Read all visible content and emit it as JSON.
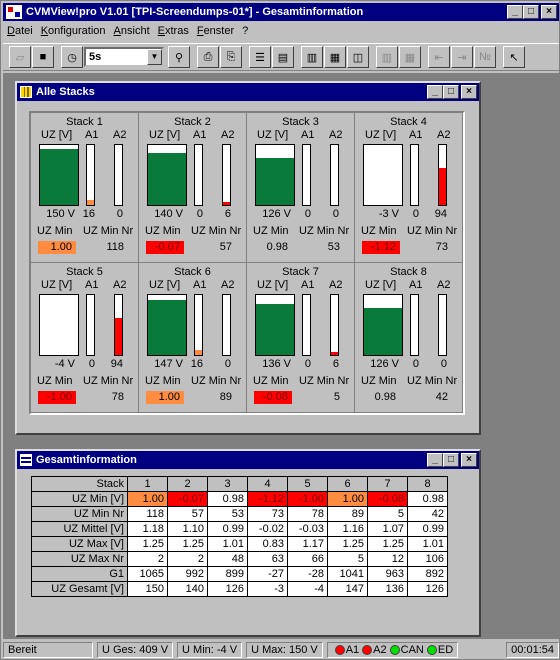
{
  "window": {
    "title": "CVMView!pro  V1.01 [TPI-Screendumps-01*] - Gesamtinformation",
    "min": "_",
    "max": "□",
    "close": "×"
  },
  "menu": [
    "Datei",
    "Konfiguration",
    "Ansicht",
    "Extras",
    "Fenster",
    "?"
  ],
  "toolbar": {
    "interval": "5s"
  },
  "stacks_window": {
    "title": "Alle Stacks",
    "col_uz": "UZ [V]",
    "col_a1": "A1",
    "col_a2": "A2",
    "label_uzmin": "UZ Min",
    "label_uzminnr": "UZ Min Nr",
    "stacks": [
      {
        "name": "Stack  1",
        "uz": "150 V",
        "a1": "16",
        "a2": "0",
        "uzmin": "1.00",
        "uzminnr": "118",
        "uz_level": 0.93,
        "a1_level": 0.08,
        "a2_level": 0.0,
        "a1_color": "#ff8c40",
        "a2_color": "#ff0000",
        "min_color": "#ff8c40",
        "min_text": "#000000"
      },
      {
        "name": "Stack  2",
        "uz": "140 V",
        "a1": "0",
        "a2": "6",
        "uzmin": "-0.07",
        "uzminnr": "57",
        "uz_level": 0.87,
        "a1_level": 0.0,
        "a2_level": 0.05,
        "a1_color": "#ff8c40",
        "a2_color": "#ff0000",
        "min_color": "#ff0000",
        "min_text": "#7a0000"
      },
      {
        "name": "Stack  3",
        "uz": "126 V",
        "a1": "0",
        "a2": "0",
        "uzmin": "0.98",
        "uzminnr": "53",
        "uz_level": 0.79,
        "a1_level": 0.0,
        "a2_level": 0.0,
        "a1_color": "#ff8c40",
        "a2_color": "#ff0000",
        "min_color": "#c0c0c0",
        "min_text": "#000000"
      },
      {
        "name": "Stack  4",
        "uz": "-3 V",
        "a1": "0",
        "a2": "94",
        "uzmin": "-1.12",
        "uzminnr": "73",
        "uz_level": 0.0,
        "a1_level": 0.0,
        "a2_level": 0.62,
        "a1_color": "#ff8c40",
        "a2_color": "#ff0000",
        "min_color": "#ff0000",
        "min_text": "#7a0000"
      },
      {
        "name": "Stack  5",
        "uz": "-4 V",
        "a1": "0",
        "a2": "94",
        "uzmin": "-1.00",
        "uzminnr": "78",
        "uz_level": 0.0,
        "a1_level": 0.0,
        "a2_level": 0.62,
        "a1_color": "#ff8c40",
        "a2_color": "#ff0000",
        "min_color": "#ff0000",
        "min_text": "#7a0000"
      },
      {
        "name": "Stack  6",
        "uz": "147 V",
        "a1": "16",
        "a2": "0",
        "uzmin": "1.00",
        "uzminnr": "89",
        "uz_level": 0.92,
        "a1_level": 0.08,
        "a2_level": 0.0,
        "a1_color": "#ff8c40",
        "a2_color": "#ff0000",
        "min_color": "#ff8c40",
        "min_text": "#000000"
      },
      {
        "name": "Stack  7",
        "uz": "136 V",
        "a1": "0",
        "a2": "6",
        "uzmin": "-0.08",
        "uzminnr": "5",
        "uz_level": 0.85,
        "a1_level": 0.0,
        "a2_level": 0.05,
        "a1_color": "#ff8c40",
        "a2_color": "#ff0000",
        "min_color": "#ff0000",
        "min_text": "#7a0000"
      },
      {
        "name": "Stack  8",
        "uz": "126 V",
        "a1": "0",
        "a2": "0",
        "uzmin": "0.98",
        "uzminnr": "42",
        "uz_level": 0.79,
        "a1_level": 0.0,
        "a2_level": 0.0,
        "a1_color": "#ff8c40",
        "a2_color": "#ff0000",
        "min_color": "#c0c0c0",
        "min_text": "#000000"
      }
    ]
  },
  "gesamt_window": {
    "title": "Gesamtinformation",
    "corner": "Stack",
    "columns": [
      "1",
      "2",
      "3",
      "4",
      "5",
      "6",
      "7",
      "8"
    ],
    "rows": [
      {
        "label": "UZ Min [V]",
        "values": [
          "1.00",
          "-0.07",
          "0.98",
          "-1.12",
          "-1.00",
          "1.00",
          "-0.08",
          "0.98"
        ],
        "bg": [
          "#ff8c40",
          "#ff0000",
          "#ffffff",
          "#ff0000",
          "#ff0000",
          "#ff8c40",
          "#ff0000",
          "#ffffff"
        ]
      },
      {
        "label": "UZ Min Nr",
        "values": [
          "118",
          "57",
          "53",
          "73",
          "78",
          "89",
          "5",
          "42"
        ]
      },
      {
        "label": "UZ Mittel [V]",
        "values": [
          "1.18",
          "1.10",
          "0.99",
          "-0.02",
          "-0.03",
          "1.16",
          "1.07",
          "0.99"
        ]
      },
      {
        "label": "UZ Max [V]",
        "values": [
          "1.25",
          "1.25",
          "1.01",
          "0.83",
          "1.17",
          "1.25",
          "1.25",
          "1.01"
        ]
      },
      {
        "label": "UZ Max Nr",
        "values": [
          "2",
          "2",
          "48",
          "63",
          "66",
          "5",
          "12",
          "106"
        ]
      },
      {
        "label": "G1",
        "values": [
          "1065",
          "992",
          "899",
          "-27",
          "-28",
          "1041",
          "963",
          "892"
        ]
      },
      {
        "label": "UZ Gesamt [V]",
        "values": [
          "150",
          "140",
          "126",
          "-3",
          "-4",
          "147",
          "136",
          "126"
        ]
      }
    ]
  },
  "statusbar": {
    "ready": "Bereit",
    "uges": "U Ges:  409 V",
    "umin": "U Min:  -4 V",
    "umax": "U Max:  150 V",
    "a1": "A1",
    "a2": "A2",
    "can": "CAN",
    "ed": "ED",
    "time": "00:01:54"
  },
  "colors": {
    "green": "#0a7a3a",
    "red": "#ff0000",
    "orange": "#ff8c40",
    "titlebar": "#000080"
  }
}
